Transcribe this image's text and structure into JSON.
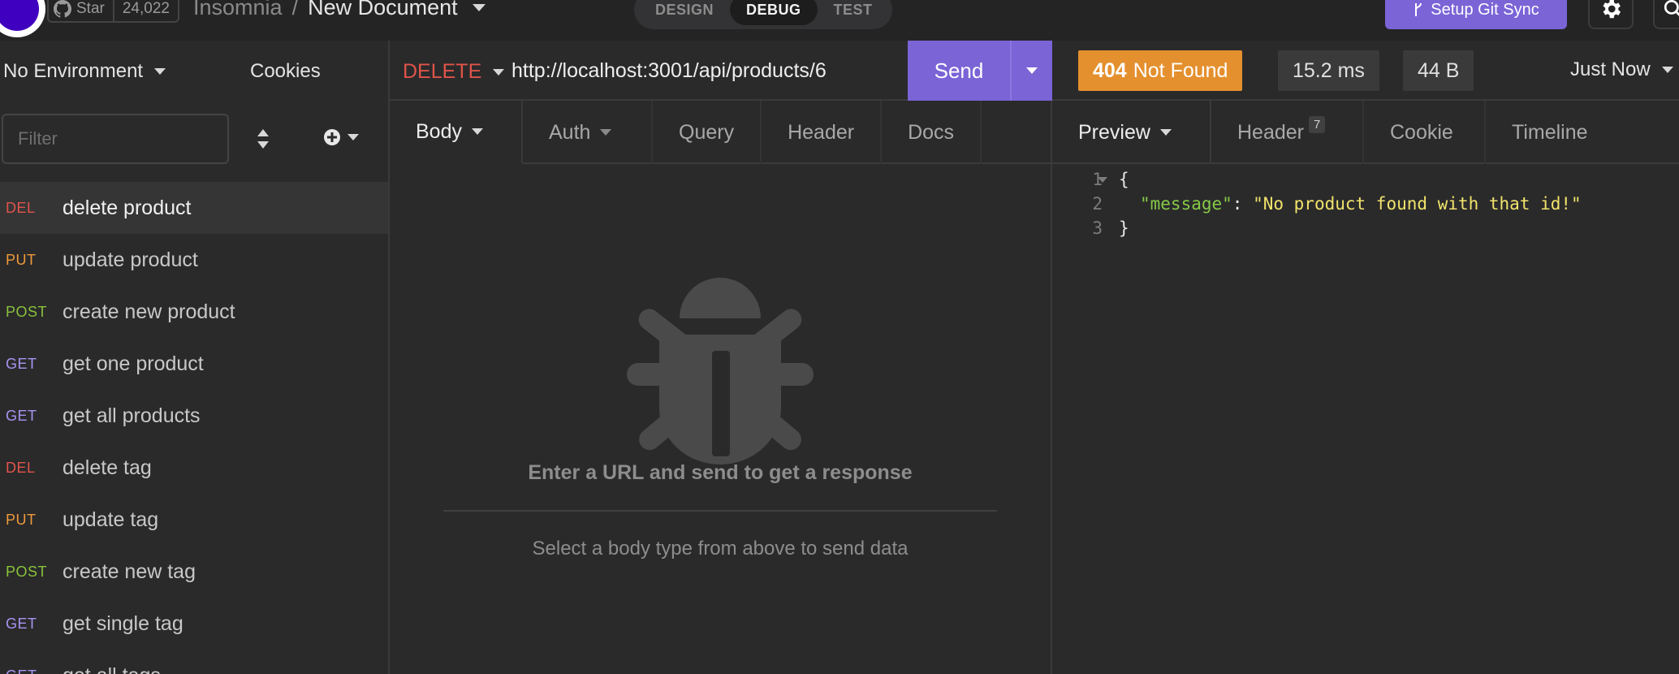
{
  "topbar": {
    "star_label": "Star",
    "star_count": "24,022",
    "project": "Insomnia",
    "separator": "/",
    "document": "New Document",
    "modes": [
      {
        "label": "DESIGN",
        "active": false
      },
      {
        "label": "DEBUG",
        "active": true
      },
      {
        "label": "TEST",
        "active": false
      }
    ],
    "git_sync_label": "Setup Git Sync",
    "icons": {
      "logo": "insomnia-logo",
      "github": "github-icon",
      "git": "git-branch-icon",
      "settings": "gear-icon",
      "search": "search-icon"
    }
  },
  "sidebar": {
    "environment": "No Environment",
    "cookies": "Cookies",
    "filter_placeholder": "Filter",
    "requests": [
      {
        "method": "DEL",
        "name": "delete product",
        "active": true
      },
      {
        "method": "PUT",
        "name": "update product",
        "active": false
      },
      {
        "method": "POST",
        "name": "create new product",
        "active": false
      },
      {
        "method": "GET",
        "name": "get one product",
        "active": false
      },
      {
        "method": "GET",
        "name": "get all products",
        "active": false
      },
      {
        "method": "DEL",
        "name": "delete tag",
        "active": false
      },
      {
        "method": "PUT",
        "name": "update tag",
        "active": false
      },
      {
        "method": "POST",
        "name": "create new tag",
        "active": false
      },
      {
        "method": "GET",
        "name": "get single tag",
        "active": false
      },
      {
        "method": "GET",
        "name": "get all tags",
        "active": false
      }
    ]
  },
  "request": {
    "method": "DELETE",
    "url": "http://localhost:3001/api/products/6",
    "send_label": "Send",
    "tabs": [
      "Body",
      "Auth",
      "Query",
      "Header",
      "Docs"
    ],
    "empty_title": "Enter a URL and send to get a response",
    "empty_sub": "Select a body type from above to send data"
  },
  "response": {
    "status_code": "404",
    "status_text": "Not Found",
    "time": "15.2 ms",
    "size": "44 B",
    "when": "Just Now",
    "tabs": [
      "Preview",
      "Header",
      "Cookie",
      "Timeline"
    ],
    "header_count": "7",
    "body_lines": [
      {
        "no": "1",
        "text": "{"
      },
      {
        "no": "2",
        "key": "\"message\"",
        "value": "\"No product found with that id!\""
      },
      {
        "no": "3",
        "text": "}"
      }
    ]
  },
  "colors": {
    "accent": "#7a64d6",
    "status_404": "#e4902e",
    "method_del": "#e0544a",
    "method_put": "#ee9a3a",
    "method_post": "#89c23a",
    "method_get": "#a994f0"
  }
}
